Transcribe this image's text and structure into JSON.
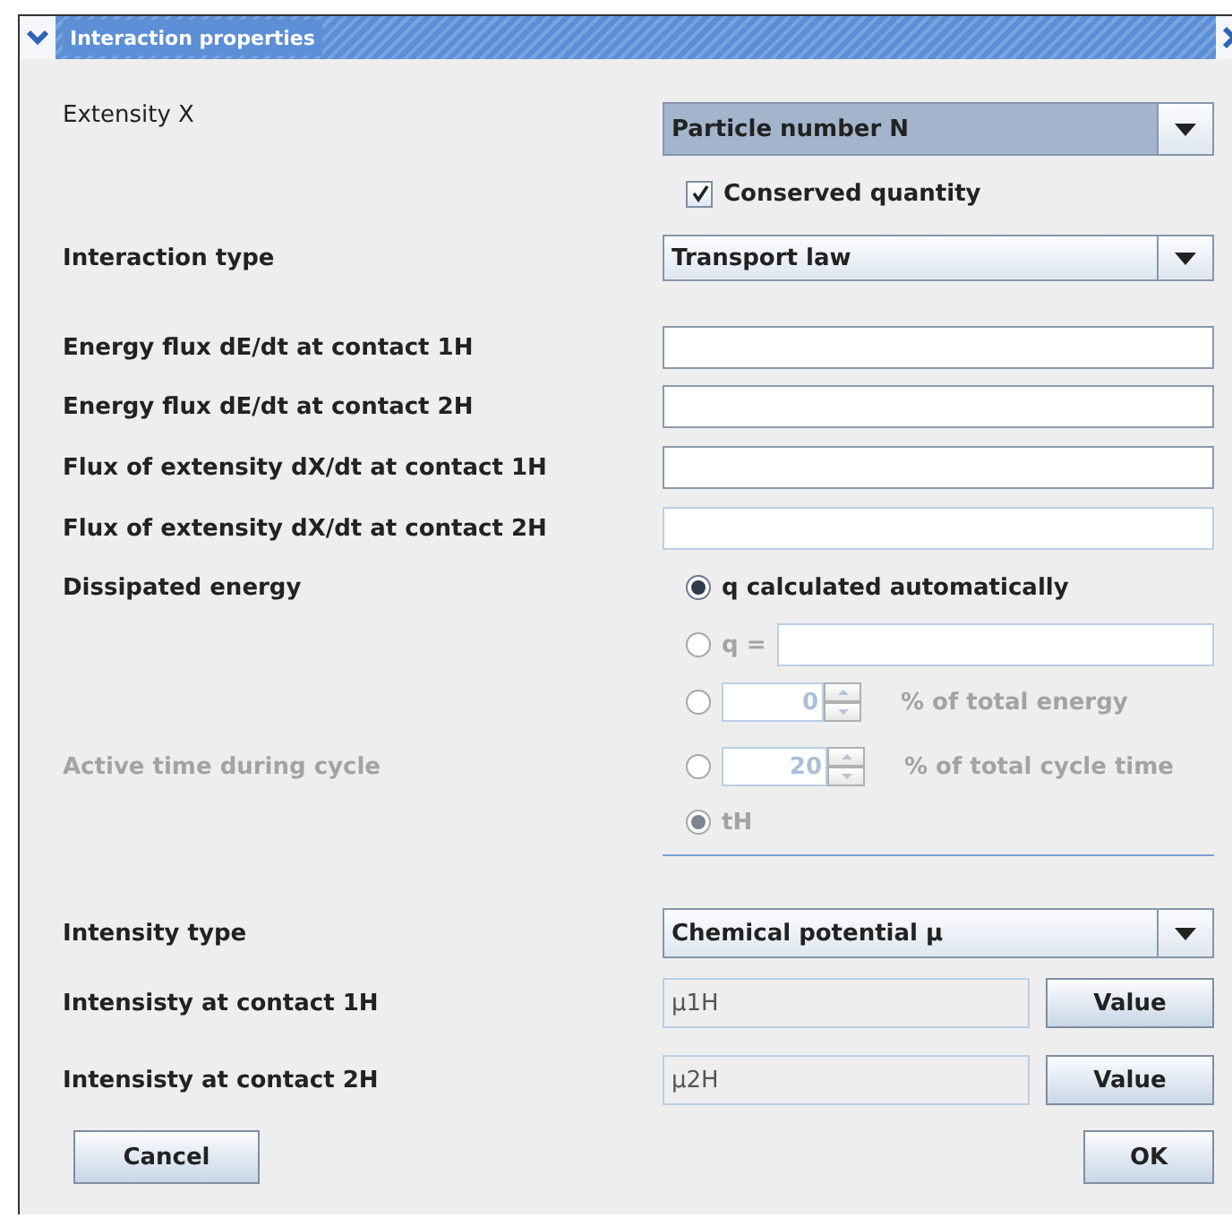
{
  "window": {
    "title": "Interaction properties"
  },
  "extensity": {
    "label": "Extensity X",
    "value": "Particle number N",
    "focused": true
  },
  "conserved": {
    "label": "Conserved quantity",
    "checked": true
  },
  "interaction_type": {
    "label": "Interaction type",
    "value": "Transport law",
    "focused": false
  },
  "fields": [
    {
      "label": "Energy flux dE/dt at contact 1H",
      "disabled": false
    },
    {
      "label": "Energy flux dE/dt at contact 2H",
      "disabled": false
    },
    {
      "label": "Flux of extensity dX/dt at contact 1H",
      "disabled": false
    },
    {
      "label": "Flux of extensity dX/dt at contact 2H",
      "disabled": true
    }
  ],
  "dissipated": {
    "label": "Dissipated energy",
    "disabled": false,
    "options": [
      {
        "kind": "plain",
        "label": "q calculated automatically",
        "selected": true,
        "disabled": false
      },
      {
        "kind": "field",
        "label": "q =",
        "selected": false,
        "disabled": true
      },
      {
        "kind": "spinner",
        "value": "0",
        "label": "% of total energy",
        "selected": false,
        "disabled": true
      }
    ]
  },
  "active_time": {
    "label": "Active time during cycle",
    "disabled": true,
    "options": [
      {
        "kind": "spinner",
        "value": "20",
        "label": "% of total cycle time",
        "selected": false,
        "disabled": true
      },
      {
        "kind": "plain",
        "label": "tH",
        "selected": true,
        "disabled": true
      }
    ]
  },
  "intensity_type": {
    "label": "Intensity type",
    "value": "Chemical potential μ",
    "focused": false
  },
  "intensities": [
    {
      "label": "Intensisty at contact 1H",
      "value": "μ1H",
      "button": "Value"
    },
    {
      "label": "Intensisty at contact 2H",
      "value": "μ2H",
      "button": "Value"
    }
  ],
  "buttons": [
    {
      "label": "Cancel"
    },
    {
      "label": "OK"
    }
  ]
}
